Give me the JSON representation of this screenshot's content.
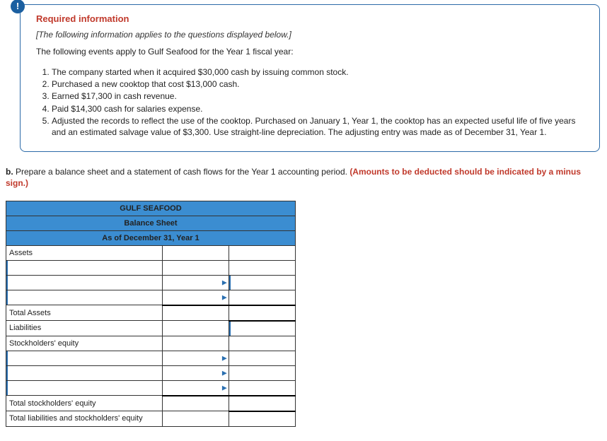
{
  "badge": "!",
  "info": {
    "required_label": "Required information",
    "italic_line": "[The following information applies to the questions displayed below.]",
    "intro": "The following events apply to Gulf Seafood for the Year 1 fiscal year:",
    "events": [
      "The company started when it acquired $30,000 cash by issuing common stock.",
      "Purchased a new cooktop that cost $13,000 cash.",
      "Earned $17,300 in cash revenue.",
      "Paid $14,300 cash for salaries expense.",
      "Adjusted the records to reflect the use of the cooktop. Purchased on January 1, Year 1, the cooktop has an expected useful life of five years and an estimated salvage value of $3,300. Use straight-line depreciation. The adjusting entry was made as of December 31, Year 1."
    ]
  },
  "question": {
    "prefix": "b.",
    "text": " Prepare a balance sheet and a statement of cash flows for the Year 1 accounting period. ",
    "red_note": "(Amounts to be deducted should be indicated by a minus sign.)"
  },
  "table": {
    "title": "GULF SEAFOOD",
    "subtitle": "Balance Sheet",
    "date_line": "As of December 31, Year 1",
    "rows": {
      "assets": "Assets",
      "total_assets": "Total Assets",
      "liabilities": "Liabilities",
      "stockholders_equity": "Stockholders' equity",
      "total_se": "Total stockholders' equity",
      "total_liab_se": "Total liabilities and stockholders' equity"
    }
  }
}
